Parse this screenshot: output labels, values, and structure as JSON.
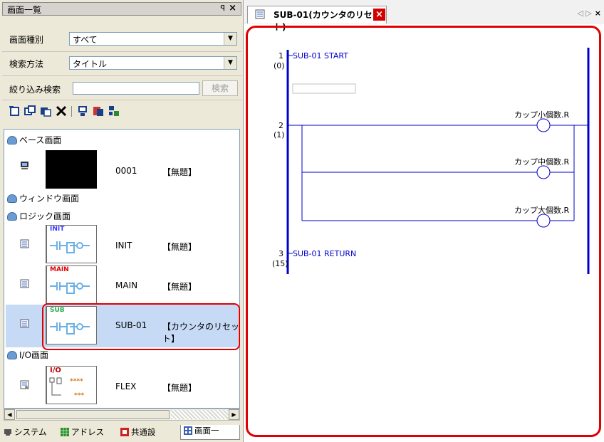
{
  "left_panel": {
    "title": "画面一覧",
    "pin": "ꟼ",
    "close": "×",
    "screen_type_label": "画面種別",
    "screen_type_value": "すべて",
    "search_method_label": "検索方法",
    "search_method_value": "タイトル",
    "filter_label": "絞り込み検索",
    "filter_value": "",
    "search_button": "検索",
    "toolbar_icons": [
      "new-screen-icon",
      "duplicate-screen-icon",
      "copy-screen-icon",
      "delete-icon",
      "screen-properties-icon",
      "sheet-icon",
      "diagram-icon"
    ]
  },
  "tree": {
    "categories": {
      "base": "ベース画面",
      "window": "ウィンドウ画面",
      "logic": "ロジック画面",
      "io": "I/O画面"
    },
    "items": [
      {
        "name": "0001",
        "title": "【無題】"
      },
      {
        "name": "INIT",
        "title": "【無題】",
        "thumb_label": "INIT",
        "thumb_color": "#3a3aff"
      },
      {
        "name": "MAIN",
        "title": "【無題】",
        "thumb_label": "MAIN",
        "thumb_color": "#e00000"
      },
      {
        "name": "SUB-01",
        "title": "【カウンタのリセット】",
        "thumb_label": "SUB",
        "thumb_color": "#22b14c"
      },
      {
        "name": "FLEX",
        "title": "【無題】",
        "thumb_label": "I/O"
      }
    ],
    "io_thumb_text_1": "****",
    "io_thumb_text_2": "***"
  },
  "bottom_tabs": [
    "システム",
    "アドレス",
    "共通設",
    "画面一"
  ],
  "editor": {
    "tab_title": "SUB-01(カウンタのリセット)",
    "tab_close": "×",
    "nav": "◁ ▷",
    "nav_close": "×",
    "rungs": [
      {
        "num": "1",
        "step": "(0)",
        "label": "SUB-01 START"
      },
      {
        "num": "2",
        "step": "(1)",
        "label": ""
      },
      {
        "num": "3",
        "step": "(15)",
        "label": "SUB-01 RETURN"
      }
    ],
    "coils": [
      "カップ小個数.R",
      "カップ中個数.R",
      "カップ大個数.R"
    ],
    "accent": "#0000cc",
    "highlight": "#e00000"
  }
}
